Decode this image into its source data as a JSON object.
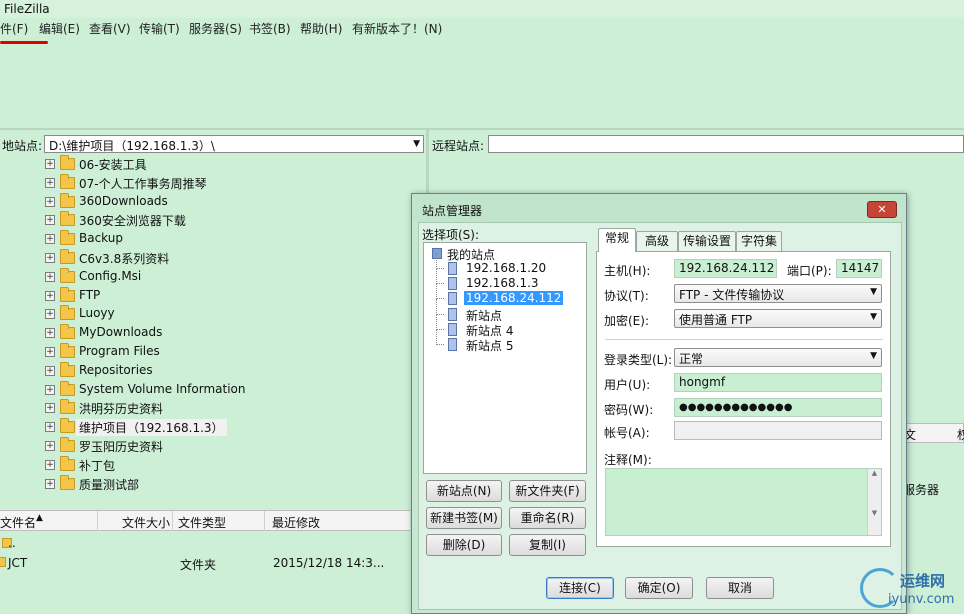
{
  "window": {
    "title": "FileZilla"
  },
  "menu": [
    "件(F)",
    "编辑(E)",
    "查看(V)",
    "传输(T)",
    "服务器(S)",
    "书签(B)",
    "帮助(H)",
    "有新版本了！(N)"
  ],
  "local": {
    "label": "地站点:",
    "path": "D:\\维护项目（192.168.1.3）\\",
    "tree": [
      "06-安装工具",
      "07-个人工作事务周推琴",
      "360Downloads",
      "360安全浏览器下载",
      "Backup",
      "C6v3.8系列资料",
      "Config.Msi",
      "FTP",
      "Luoyy",
      "MyDownloads",
      "Program Files",
      "Repositories",
      "System Volume Information",
      "洪明芬历史资料",
      "维护项目（192.168.1.3）",
      "罗玉阳历史资料",
      "补丁包",
      "质量测试部"
    ],
    "tree_selected": "维护项目（192.168.1.3）",
    "columns": [
      "文件名",
      "文件大小",
      "文件类型",
      "最近修改"
    ],
    "rows": [
      {
        "name": "..",
        "size": "",
        "type": "",
        "modified": ""
      },
      {
        "name": "JCT",
        "size": "",
        "type": "文件夹",
        "modified": "2015/12/18 14:3..."
      }
    ]
  },
  "remote": {
    "label": "远程站点:",
    "header_frag": "文",
    "header_frag2": "权",
    "text_frag": "服务器"
  },
  "site_manager": {
    "title": "站点管理器",
    "close": "✕",
    "select_label": "选择项(S):",
    "root": "我的站点",
    "sites": [
      "192.168.1.20",
      "192.168.1.3",
      "192.168.24.112",
      "新站点",
      "新站点 4",
      "新站点 5"
    ],
    "selected_site": "192.168.24.112",
    "buttons": {
      "new_site": "新站点(N)",
      "new_folder": "新文件夹(F)",
      "new_bookmark": "新建书签(M)",
      "rename": "重命名(R)",
      "delete": "删除(D)",
      "copy": "复制(I)",
      "connect": "连接(C)",
      "ok": "确定(O)",
      "cancel": "取消"
    },
    "tabs": [
      "常规",
      "高级",
      "传输设置",
      "字符集"
    ],
    "active_tab": "常规",
    "form": {
      "host_label": "主机(H):",
      "host": "192.168.24.112",
      "port_label": "端口(P):",
      "port": "14147",
      "protocol_label": "协议(T):",
      "protocol": "FTP - 文件传输协议",
      "encryption_label": "加密(E):",
      "encryption": "使用普通 FTP",
      "logon_label": "登录类型(L):",
      "logon": "正常",
      "user_label": "用户(U):",
      "user": "hongmf",
      "password_label": "密码(W):",
      "password": "●●●●●●●●●●●●●",
      "account_label": "帐号(A):",
      "account": "",
      "comment_label": "注释(M):"
    }
  },
  "watermark": {
    "line1": "运维网",
    "line2": "iyunv.com"
  }
}
